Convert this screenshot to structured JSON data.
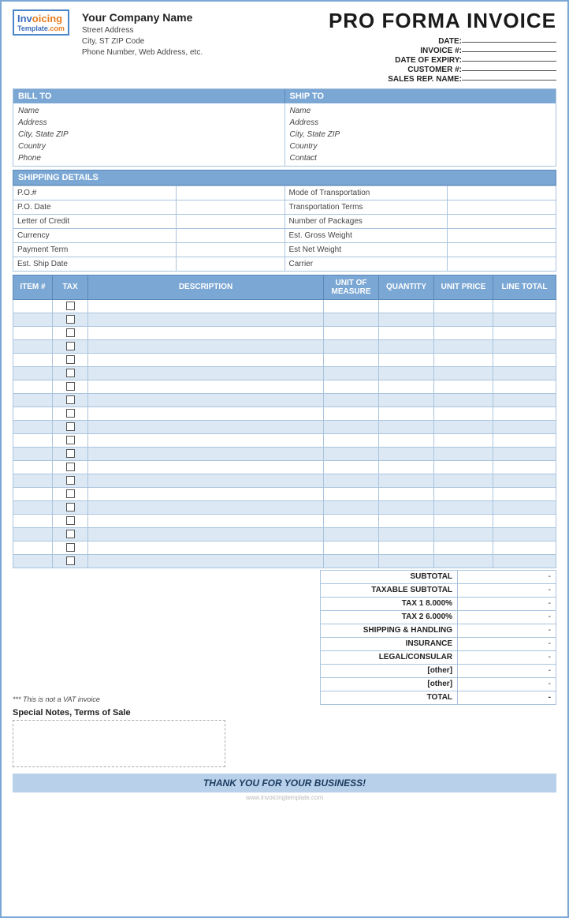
{
  "header": {
    "company_name": "Your Company Name",
    "street_address": "Street Address",
    "city_state_zip": "City, ST  ZIP Code",
    "phone_web": "Phone Number, Web Address, etc.",
    "invoice_title": "PRO FORMA INVOICE",
    "meta": {
      "date_label": "DATE:",
      "date_value": "",
      "invoice_num_label": "INVOICE #:",
      "invoice_num_value": "",
      "expiry_label": "DATE OF EXPIRY:",
      "expiry_value": "",
      "customer_label": "CUSTOMER #:",
      "customer_value": "",
      "sales_rep_label": "SALES REP. NAME:",
      "sales_rep_value": ""
    }
  },
  "bill_to": {
    "header": "BILL TO",
    "name": "Name",
    "address": "Address",
    "city_state_zip": "City, State ZIP",
    "country": "Country",
    "phone": "Phone"
  },
  "ship_to": {
    "header": "SHIP TO",
    "name": "Name",
    "address": "Address",
    "city_state_zip": "City, State ZIP",
    "country": "Country",
    "contact": "Contact"
  },
  "shipping_details": {
    "header": "SHIPPING DETAILS",
    "rows": [
      {
        "label1": "P.O.#",
        "value1": "",
        "label2": "Mode of Transportation",
        "value2": ""
      },
      {
        "label1": "P.O. Date",
        "value1": "",
        "label2": "Transportation Terms",
        "value2": ""
      },
      {
        "label1": "Letter of Credit",
        "value1": "",
        "label2": "Number of Packages",
        "value2": ""
      },
      {
        "label1": "Currency",
        "value1": "",
        "label2": "Est. Gross Weight",
        "value2": ""
      },
      {
        "label1": "Payment Term",
        "value1": "",
        "label2": "Est Net Weight",
        "value2": ""
      },
      {
        "label1": "Est. Ship Date",
        "value1": "",
        "label2": "Carrier",
        "value2": ""
      }
    ]
  },
  "items_table": {
    "columns": [
      "ITEM #",
      "TAX",
      "DESCRIPTION",
      "UNIT OF MEASURE",
      "QUANTITY",
      "UNIT PRICE",
      "LINE TOTAL"
    ],
    "rows": 20
  },
  "summary": {
    "vat_note": "*** This is not a VAT invoice",
    "rows": [
      {
        "label": "SUBTOTAL",
        "value": "-"
      },
      {
        "label": "TAXABLE SUBTOTAL",
        "value": "-"
      },
      {
        "label": "TAX 1       8.000%",
        "value": "-"
      },
      {
        "label": "TAX 2       6.000%",
        "value": "-"
      },
      {
        "label": "SHIPPING & HANDLING",
        "value": "-"
      },
      {
        "label": "INSURANCE",
        "value": "-"
      },
      {
        "label": "LEGAL/CONSULAR",
        "value": "-"
      },
      {
        "label": "[other]",
        "value": "-"
      },
      {
        "label": "[other]",
        "value": "-"
      },
      {
        "label": "TOTAL",
        "value": "-",
        "is_total": true
      }
    ]
  },
  "notes": {
    "label": "Special Notes, Terms of Sale"
  },
  "footer": {
    "thank_you": "THANK YOU FOR YOUR BUSINESS!"
  },
  "logo": {
    "inv": "Inv",
    "oicing": "oicing",
    "template": "Template",
    "com": ".com"
  }
}
